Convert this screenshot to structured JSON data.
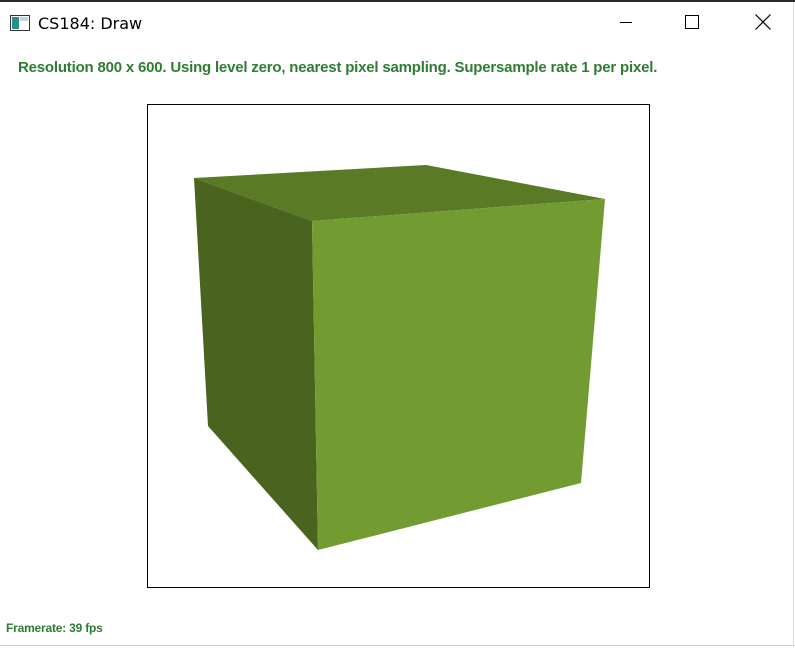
{
  "window": {
    "title": "CS184: Draw",
    "icon": "app-window-icon",
    "controls": {
      "minimize_icon": "minimize-icon",
      "maximize_icon": "maximize-icon",
      "close_icon": "close-icon"
    }
  },
  "status": {
    "resolution_text": "Resolution 800 x 600. Using level zero, nearest pixel sampling. Supersample rate 1 per pixel."
  },
  "footer": {
    "framerate_text": "Framerate: 39 fps"
  },
  "scene": {
    "object": "cube",
    "colors": {
      "top_face": "#5a7a26",
      "left_face": "#4a6420",
      "front_face": "#729c32",
      "text": "#2e7d32"
    }
  }
}
